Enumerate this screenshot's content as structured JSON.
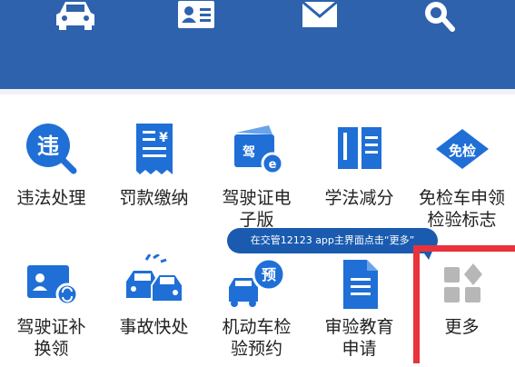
{
  "header": {
    "icons": [
      "car-icon",
      "id-card-icon",
      "mail-icon",
      "search-icon"
    ],
    "color": "#2e62ad"
  },
  "services": {
    "row1": [
      {
        "lines": [
          "违法处理"
        ],
        "icon": "violation-icon"
      },
      {
        "lines": [
          "罚款缴纳"
        ],
        "icon": "fine-receipt-icon"
      },
      {
        "lines": [
          "驾驶证电",
          "子版"
        ],
        "icon": "e-license-icon"
      },
      {
        "lines": [
          "学法减分"
        ],
        "icon": "study-book-icon"
      },
      {
        "lines": [
          "免检车申领",
          "检验标志"
        ],
        "icon": "exempt-badge-icon"
      }
    ],
    "row2": [
      {
        "lines": [
          "驾驶证补",
          "换领"
        ],
        "icon": "license-renew-icon"
      },
      {
        "lines": [
          "事故快处"
        ],
        "icon": "accident-icon"
      },
      {
        "lines": [
          "机动车检",
          "验预约"
        ],
        "icon": "inspection-booking-icon"
      },
      {
        "lines": [
          "审验教育",
          "申请"
        ],
        "icon": "education-doc-icon"
      },
      {
        "lines": [
          "更多"
        ],
        "icon": "more-grid-icon"
      }
    ]
  },
  "callout": {
    "text": "在交管12123 app主界面点击“更多”"
  },
  "colors": {
    "accent": "#2e62ad",
    "icon_blue": "#1f6fd6",
    "highlight": "#e8323c",
    "more_gray": "#b7b7b7"
  }
}
